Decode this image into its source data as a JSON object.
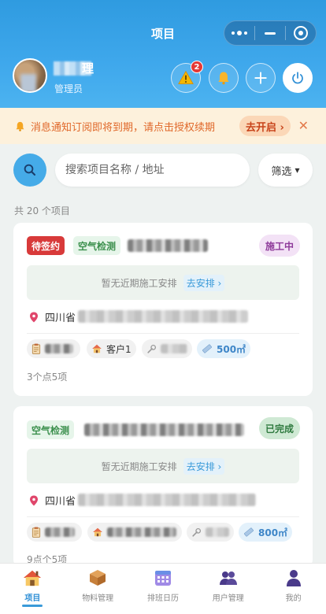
{
  "header": {
    "title": "项目",
    "user_name_suffix": "理",
    "role": "管理员",
    "alert_count": "2"
  },
  "notice": {
    "text": "消息通知订阅即将到期，请点击授权续期",
    "button": "去开启 ›",
    "close": "✕"
  },
  "search": {
    "placeholder": "搜索项目名称 / 地址",
    "filter_label": "筛选",
    "filter_arrow": "▾"
  },
  "project_count": "共 20 个项目",
  "projects": [
    {
      "tags": [
        "待签约",
        "空气检测"
      ],
      "status": "施工中",
      "schedule_text": "暂无近期施工安排",
      "schedule_link": "去安排 ›",
      "address_prefix": "四川省",
      "chip_customer": "客户1",
      "area": "500㎡",
      "footer": "3个点5项"
    },
    {
      "tags": [
        "空气检测"
      ],
      "status": "已完成",
      "schedule_text": "暂无近期施工安排",
      "schedule_link": "去安排 ›",
      "address_prefix": "四川省",
      "area": "800㎡",
      "footer": "9点个5项"
    }
  ],
  "tabs": [
    {
      "label": "项目",
      "icon": "house-icon",
      "active": true
    },
    {
      "label": "物料管理",
      "icon": "box-icon"
    },
    {
      "label": "排班日历",
      "icon": "calendar-icon"
    },
    {
      "label": "用户管理",
      "icon": "users-icon"
    },
    {
      "label": "我的",
      "icon": "person-icon"
    }
  ],
  "colors": {
    "header": "#3fa8ec",
    "accent": "#2f8fd6",
    "notice_text": "#e0682a",
    "tag_red": "#d83a3a",
    "status_purple": "#8e3a9a",
    "status_green": "#2f7a3f"
  }
}
